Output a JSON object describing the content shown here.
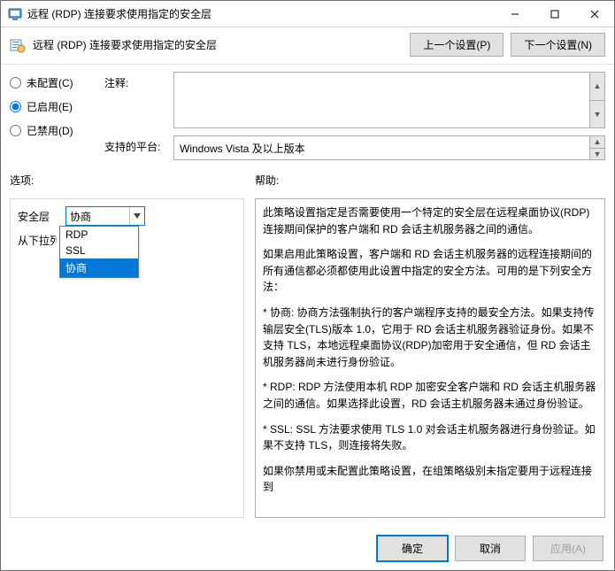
{
  "window": {
    "title": "远程 (RDP) 连接要求使用指定的安全层"
  },
  "header": {
    "title": "远程 (RDP) 连接要求使用指定的安全层",
    "prev_button": "上一个设置(P)",
    "next_button": "下一个设置(N)"
  },
  "radios": {
    "not_configured": "未配置(C)",
    "enabled": "已启用(E)",
    "disabled": "已禁用(D)",
    "selected": "enabled"
  },
  "fields": {
    "comment_label": "注释:",
    "comment_value": "",
    "platform_label": "支持的平台:",
    "platform_value": "Windows Vista 及以上版本"
  },
  "sections": {
    "options_label": "选项:",
    "help_label": "帮助:"
  },
  "options": {
    "security_layer_label": "安全层",
    "below_label_clipped": "从下拉列",
    "combo_value": "协商",
    "dropdown_items": [
      {
        "label": "RDP",
        "selected": false
      },
      {
        "label": "SSL",
        "selected": false
      },
      {
        "label": "协商",
        "selected": true
      }
    ]
  },
  "help": {
    "p1": "此策略设置指定是否需要使用一个特定的安全层在远程桌面协议(RDP)连接期间保护的客户端和 RD 会话主机服务器之间的通信。",
    "p2": "如果启用此策略设置，客户端和 RD 会话主机服务器的远程连接期间的所有通信都必须都使用此设置中指定的安全方法。可用的是下列安全方法：",
    "p3": "* 协商: 协商方法强制执行的客户端程序支持的最安全方法。如果支持传输层安全(TLS)版本 1.0，它用于 RD 会话主机服务器验证身份。如果不支持 TLS，本地远程桌面协议(RDP)加密用于安全通信，但 RD 会话主机服务器尚未进行身份验证。",
    "p4": "* RDP: RDP 方法使用本机 RDP 加密安全客户端和 RD 会话主机服务器之间的通信。如果选择此设置，RD 会话主机服务器未通过身份验证。",
    "p5": "* SSL: SSL 方法要求使用 TLS 1.0 对会话主机服务器进行身份验证。如果不支持 TLS，则连接将失败。",
    "p6": "如果你禁用或未配置此策略设置，在组策略级别未指定要用于远程连接到"
  },
  "buttons": {
    "ok": "确定",
    "cancel": "取消",
    "apply": "应用(A)"
  }
}
